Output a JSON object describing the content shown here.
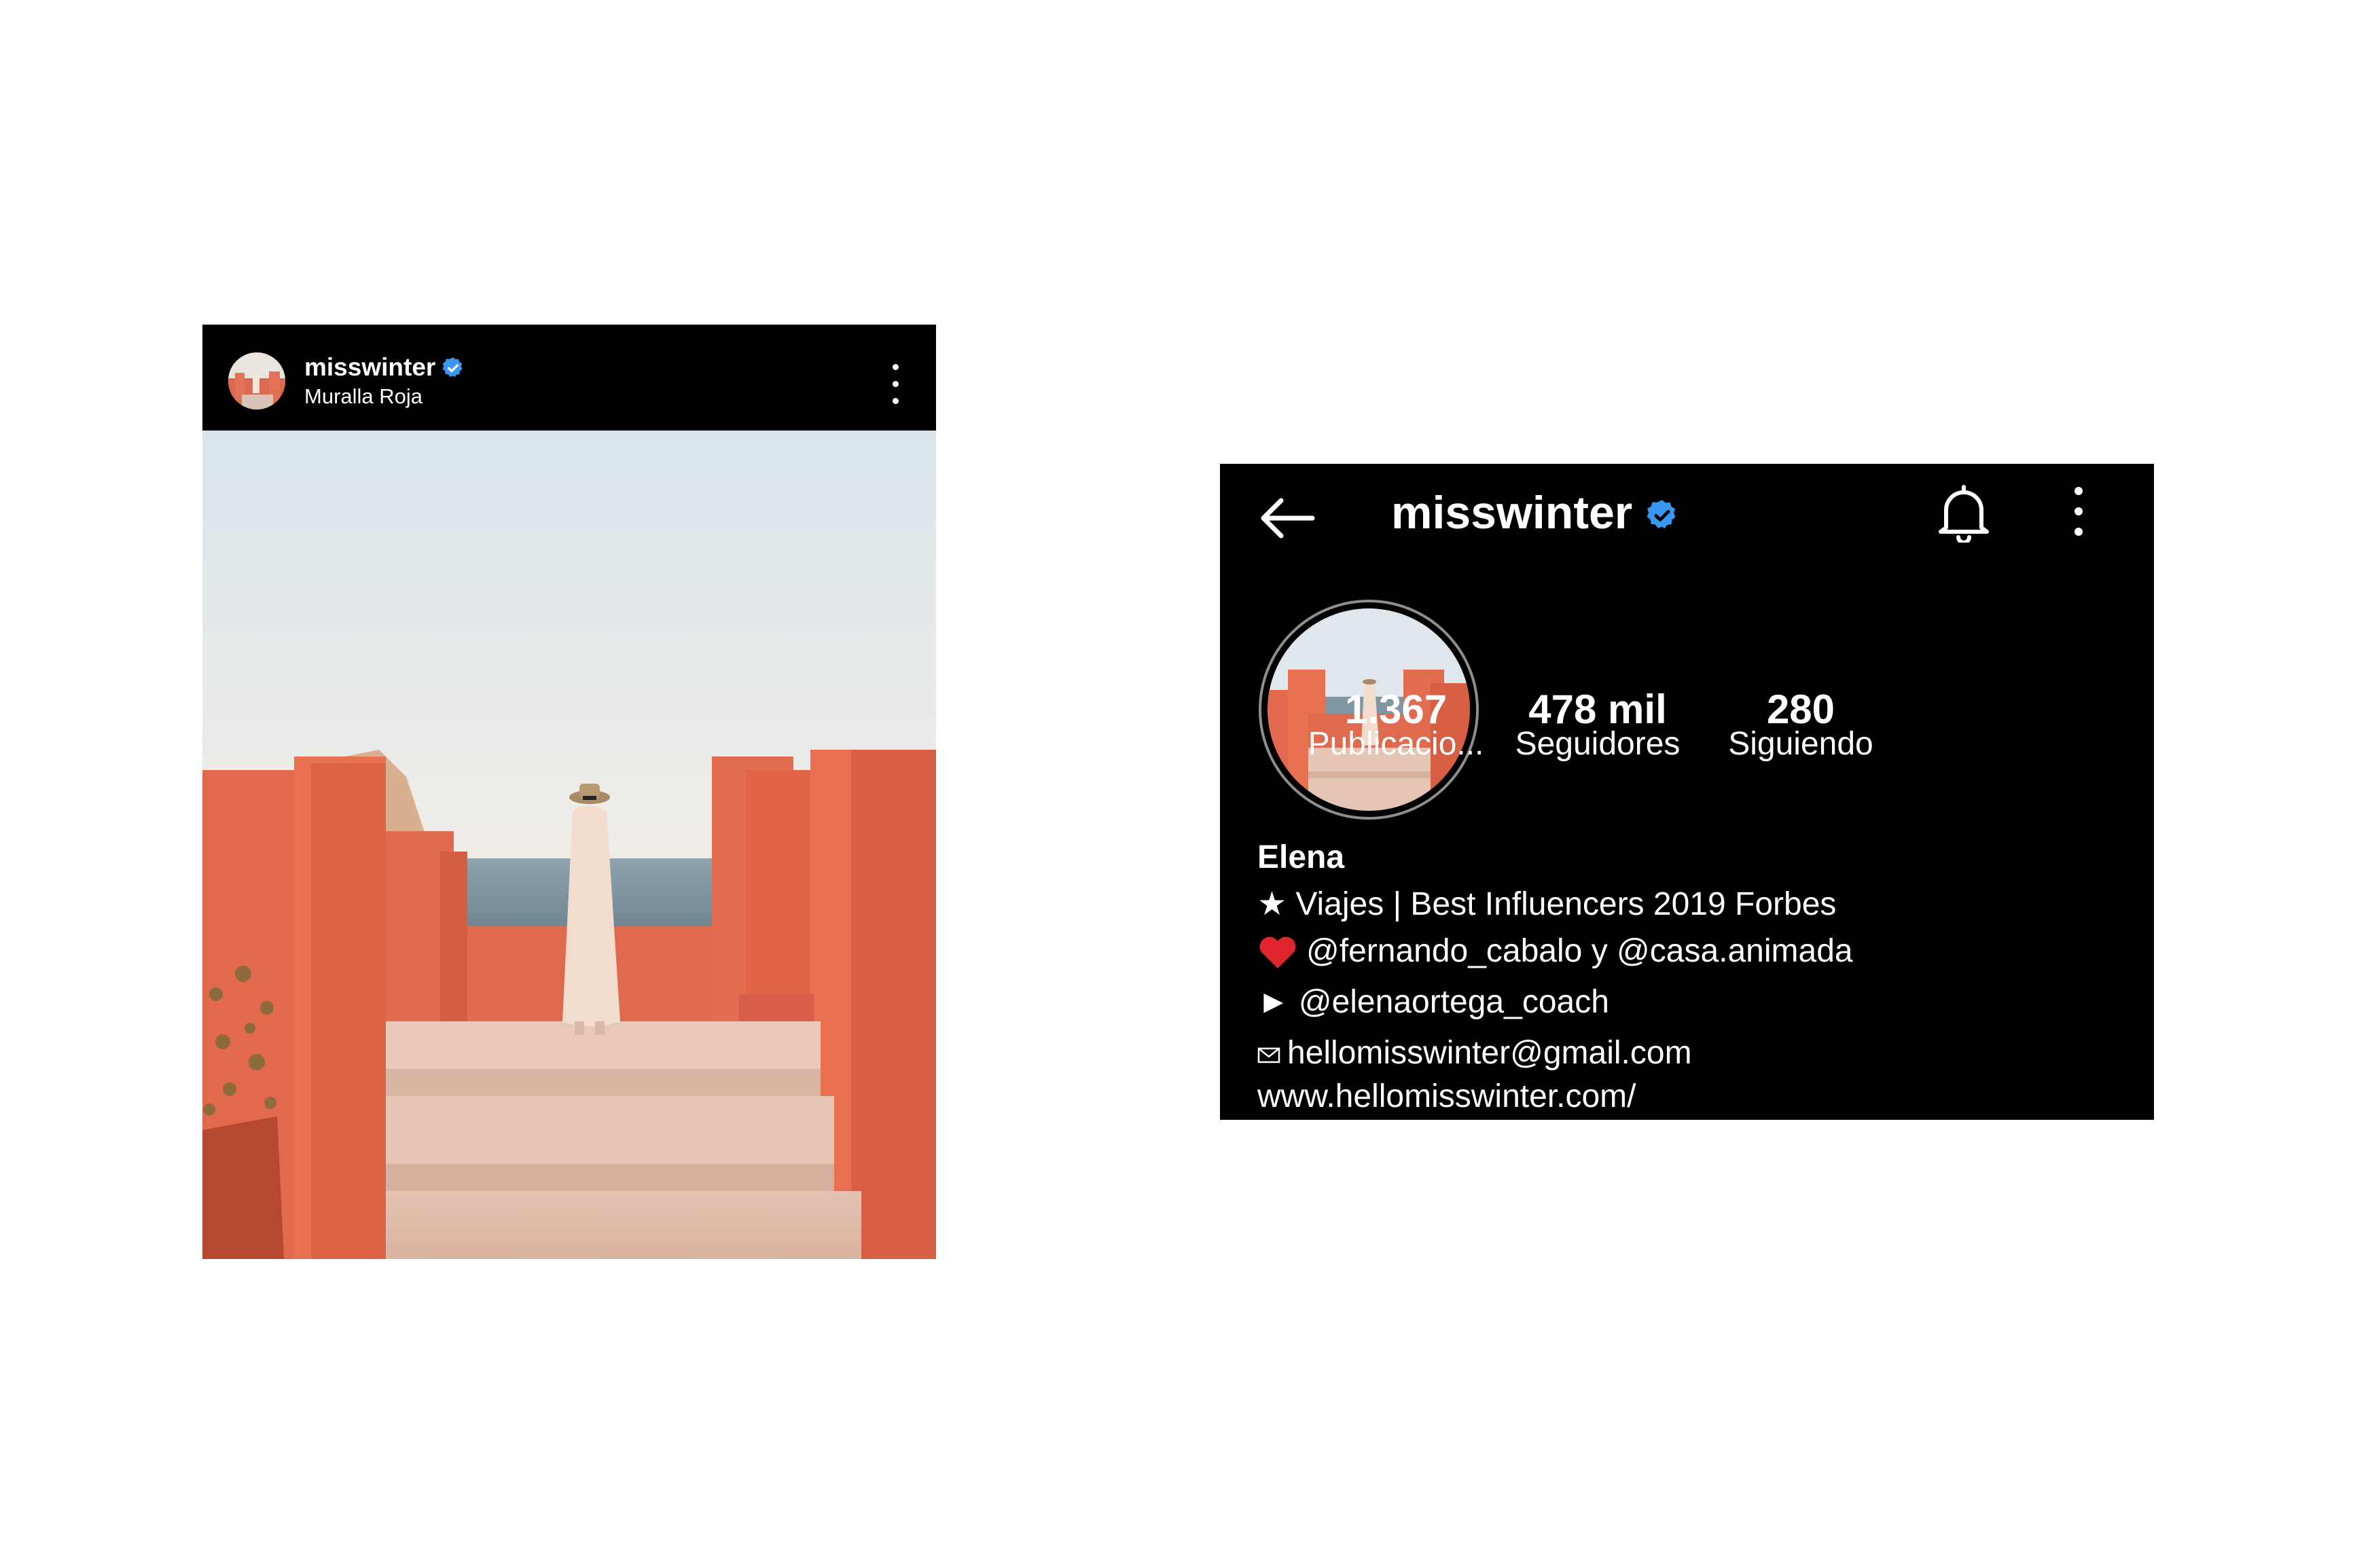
{
  "post": {
    "username": "misswinter",
    "location": "Muralla Roja"
  },
  "profile": {
    "username": "misswinter",
    "stats": [
      {
        "value": "1.367",
        "label": "Publicacio..."
      },
      {
        "value": "478 mil",
        "label": "Seguidores"
      },
      {
        "value": "280",
        "label": "Siguiendo"
      }
    ],
    "name": "Elena",
    "bio": [
      {
        "icon": "star-icon",
        "text": "★ Viajes | Best Influencers 2019 Forbes"
      },
      {
        "icon": "heart-icon",
        "text": "@fernando_cabalo y @casa.animada"
      },
      {
        "icon": "play-icon",
        "text": "► @elenaortega_coach"
      },
      {
        "icon": "envelope-icon",
        "text": "hellomisswinter@gmail.com"
      }
    ],
    "website": "www.hellomisswinter.com/"
  },
  "colors": {
    "background": "#ffffff",
    "panel": "#000000",
    "verified": "#3897f0",
    "wall": "#e06a4e",
    "sky": "#e6ecef",
    "heart": "#e0262c"
  }
}
